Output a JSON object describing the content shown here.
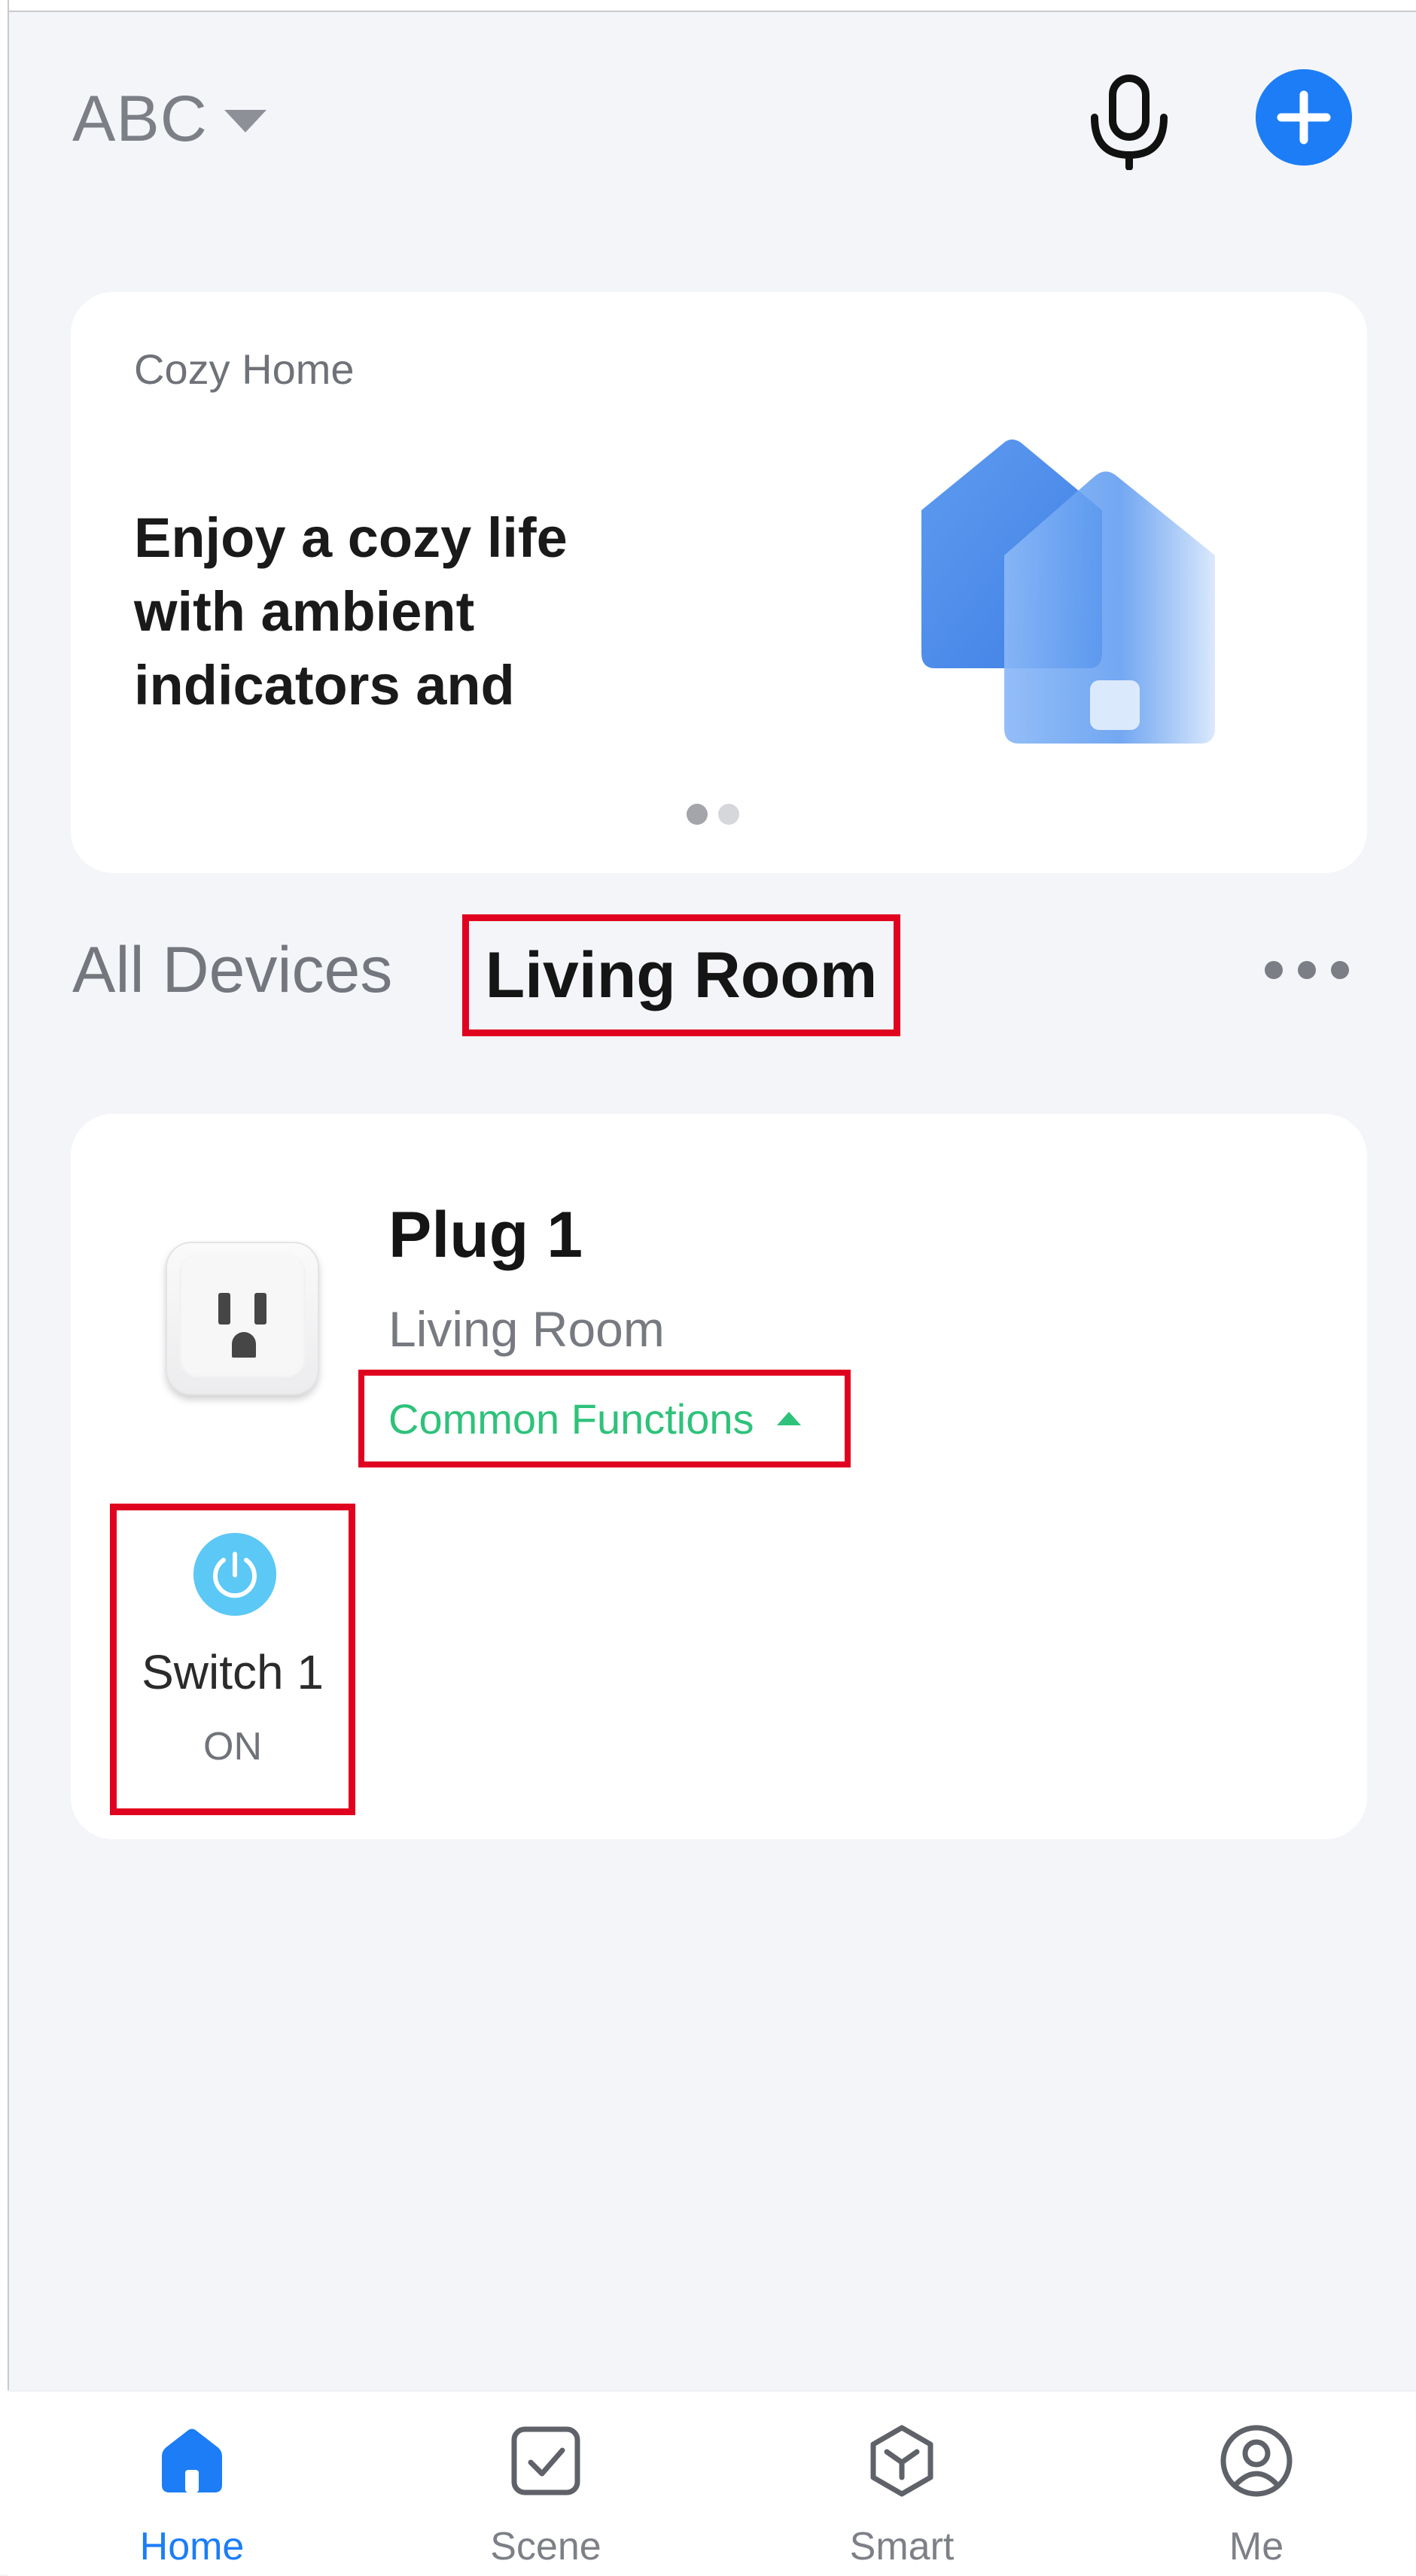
{
  "header": {
    "home_name": "ABC",
    "icons": {
      "dropdown": "chevron-down-icon",
      "voice": "microphone-icon",
      "add": "plus-icon"
    }
  },
  "banner": {
    "label": "Cozy Home",
    "headline_lines": [
      "Enjoy a cozy life",
      "with ambient",
      "indicators and"
    ],
    "page_count": 2,
    "active_page": 1
  },
  "tabs": {
    "all_devices": "All Devices",
    "living_room": "Living Room",
    "more_icon": "more-horizontal-icon"
  },
  "device": {
    "name": "Plug 1",
    "room": "Living Room",
    "common_functions_label": "Common Functions",
    "switch": {
      "label": "Switch 1",
      "state": "ON"
    }
  },
  "nav": {
    "items": [
      {
        "label": "Home",
        "icon": "home-icon",
        "active": true
      },
      {
        "label": "Scene",
        "icon": "scene-icon",
        "active": false
      },
      {
        "label": "Smart",
        "icon": "smart-icon",
        "active": false
      },
      {
        "label": "Me",
        "icon": "profile-icon",
        "active": false
      }
    ]
  },
  "colors": {
    "accent_blue": "#1c7df6",
    "highlight_red": "#e0031f",
    "function_green": "#2ec27a",
    "power_blue": "#5cc8f5",
    "background": "#f4f5f9"
  }
}
